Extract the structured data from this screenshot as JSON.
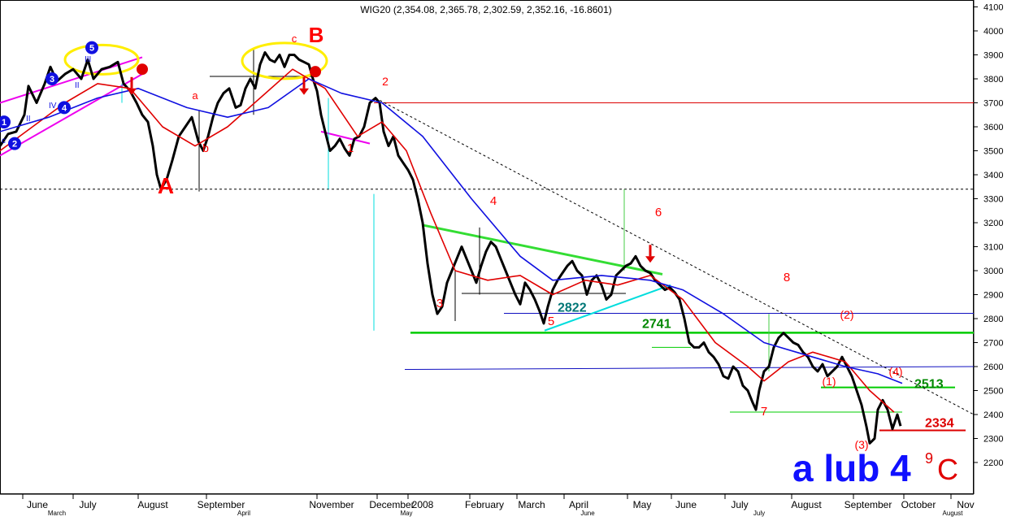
{
  "chart_data": {
    "type": "line",
    "title": "WIG20 (2,354.08, 2,365.78, 2,302.59, 2,352.16, -16.8601)",
    "ylim": [
      2100,
      4150
    ],
    "y_ticks": [
      2200,
      2300,
      2400,
      2500,
      2600,
      2700,
      2800,
      2900,
      3000,
      3100,
      3200,
      3300,
      3400,
      3500,
      3600,
      3700,
      3800,
      3900,
      4000,
      4100
    ],
    "x_month_labels": [
      "June",
      "July",
      "August",
      "September",
      "November",
      "December",
      "2008",
      "February",
      "March",
      "April",
      "May",
      "June",
      "July",
      "August",
      "September",
      "October",
      "Nov"
    ],
    "x_small_labels": [
      "March",
      "April",
      "May",
      "June",
      "July",
      "August"
    ],
    "colors": {
      "price": "#000000",
      "ma_fast": "#e00000",
      "ma_slow": "#1010e0",
      "support": "#00cc00",
      "resistance_red": "#dd0000",
      "blue_level": "#1010c0",
      "trend_cyan": "#00dddd",
      "channel_magenta": "#ee00ee",
      "ellipse_yellow": "#ffee00",
      "wave_label": "#ff0000",
      "level_label_green": "#008800",
      "level_label_teal": "#007777"
    },
    "series": [
      {
        "values": [
          [
            0,
            3520
          ],
          [
            10,
            3570
          ],
          [
            20,
            3580
          ],
          [
            30,
            3650
          ],
          [
            35,
            3770
          ],
          [
            45,
            3700
          ],
          [
            55,
            3780
          ],
          [
            62,
            3850
          ],
          [
            70,
            3790
          ],
          [
            80,
            3820
          ],
          [
            90,
            3840
          ],
          [
            100,
            3800
          ],
          [
            108,
            3880
          ],
          [
            115,
            3800
          ],
          [
            125,
            3840
          ],
          [
            135,
            3850
          ],
          [
            145,
            3870
          ],
          [
            152,
            3780
          ],
          [
            160,
            3750
          ],
          [
            168,
            3700
          ],
          [
            175,
            3650
          ],
          [
            182,
            3620
          ],
          [
            188,
            3520
          ],
          [
            193,
            3400
          ],
          [
            198,
            3340
          ],
          [
            205,
            3380
          ],
          [
            212,
            3460
          ],
          [
            220,
            3560
          ],
          [
            228,
            3600
          ],
          [
            236,
            3640
          ],
          [
            244,
            3540
          ],
          [
            250,
            3500
          ],
          [
            256,
            3560
          ],
          [
            262,
            3640
          ],
          [
            268,
            3700
          ],
          [
            275,
            3740
          ],
          [
            282,
            3760
          ],
          [
            290,
            3680
          ],
          [
            296,
            3690
          ],
          [
            302,
            3760
          ],
          [
            308,
            3800
          ],
          [
            314,
            3760
          ],
          [
            320,
            3860
          ],
          [
            326,
            3910
          ],
          [
            332,
            3880
          ],
          [
            338,
            3870
          ],
          [
            344,
            3900
          ],
          [
            350,
            3850
          ],
          [
            356,
            3900
          ],
          [
            362,
            3900
          ],
          [
            368,
            3880
          ],
          [
            374,
            3870
          ],
          [
            380,
            3860
          ],
          [
            385,
            3800
          ],
          [
            390,
            3750
          ],
          [
            395,
            3650
          ],
          [
            400,
            3580
          ],
          [
            406,
            3500
          ],
          [
            412,
            3520
          ],
          [
            418,
            3550
          ],
          [
            424,
            3510
          ],
          [
            430,
            3480
          ],
          [
            436,
            3550
          ],
          [
            442,
            3560
          ],
          [
            448,
            3600
          ],
          [
            455,
            3700
          ],
          [
            462,
            3720
          ],
          [
            467,
            3700
          ],
          [
            472,
            3580
          ],
          [
            478,
            3520
          ],
          [
            484,
            3560
          ],
          [
            490,
            3480
          ],
          [
            496,
            3450
          ],
          [
            502,
            3420
          ],
          [
            508,
            3380
          ],
          [
            514,
            3300
          ],
          [
            520,
            3200
          ],
          [
            526,
            3030
          ],
          [
            532,
            2900
          ],
          [
            538,
            2820
          ],
          [
            544,
            2850
          ],
          [
            550,
            2950
          ],
          [
            556,
            3000
          ],
          [
            562,
            3050
          ],
          [
            568,
            3100
          ],
          [
            574,
            3050
          ],
          [
            580,
            3000
          ],
          [
            586,
            2950
          ],
          [
            592,
            3020
          ],
          [
            598,
            3080
          ],
          [
            604,
            3120
          ],
          [
            610,
            3100
          ],
          [
            616,
            3050
          ],
          [
            622,
            3000
          ],
          [
            628,
            2950
          ],
          [
            634,
            2900
          ],
          [
            640,
            2860
          ],
          [
            646,
            2950
          ],
          [
            652,
            2920
          ],
          [
            658,
            2880
          ],
          [
            664,
            2830
          ],
          [
            669,
            2780
          ],
          [
            674,
            2850
          ],
          [
            680,
            2920
          ],
          [
            686,
            2960
          ],
          [
            692,
            2990
          ],
          [
            698,
            3020
          ],
          [
            704,
            3040
          ],
          [
            710,
            3000
          ],
          [
            716,
            2980
          ],
          [
            722,
            2900
          ],
          [
            728,
            2960
          ],
          [
            734,
            2980
          ],
          [
            740,
            2940
          ],
          [
            746,
            2880
          ],
          [
            752,
            2900
          ],
          [
            758,
            2980
          ],
          [
            764,
            3000
          ],
          [
            770,
            3020
          ],
          [
            776,
            3030
          ],
          [
            782,
            3060
          ],
          [
            788,
            3020
          ],
          [
            794,
            3000
          ],
          [
            800,
            2990
          ],
          [
            806,
            2960
          ],
          [
            812,
            2940
          ],
          [
            818,
            2920
          ],
          [
            824,
            2930
          ],
          [
            830,
            2910
          ],
          [
            836,
            2880
          ],
          [
            842,
            2800
          ],
          [
            848,
            2700
          ],
          [
            854,
            2680
          ],
          [
            860,
            2680
          ],
          [
            866,
            2700
          ],
          [
            872,
            2660
          ],
          [
            878,
            2640
          ],
          [
            884,
            2610
          ],
          [
            890,
            2560
          ],
          [
            896,
            2550
          ],
          [
            902,
            2600
          ],
          [
            908,
            2580
          ],
          [
            914,
            2520
          ],
          [
            920,
            2500
          ],
          [
            926,
            2450
          ],
          [
            930,
            2420
          ],
          [
            934,
            2500
          ],
          [
            940,
            2580
          ],
          [
            946,
            2600
          ],
          [
            952,
            2680
          ],
          [
            958,
            2720
          ],
          [
            964,
            2740
          ],
          [
            970,
            2720
          ],
          [
            976,
            2700
          ],
          [
            982,
            2690
          ],
          [
            988,
            2660
          ],
          [
            994,
            2640
          ],
          [
            1000,
            2600
          ],
          [
            1006,
            2580
          ],
          [
            1012,
            2610
          ],
          [
            1018,
            2560
          ],
          [
            1024,
            2580
          ],
          [
            1030,
            2600
          ],
          [
            1036,
            2640
          ],
          [
            1042,
            2600
          ],
          [
            1048,
            2560
          ],
          [
            1054,
            2500
          ],
          [
            1060,
            2440
          ],
          [
            1066,
            2350
          ],
          [
            1070,
            2280
          ],
          [
            1076,
            2300
          ],
          [
            1080,
            2420
          ],
          [
            1086,
            2460
          ],
          [
            1092,
            2420
          ],
          [
            1098,
            2340
          ],
          [
            1104,
            2400
          ],
          [
            1108,
            2352
          ]
        ]
      },
      {
        "values": [
          [
            0,
            3500
          ],
          [
            40,
            3600
          ],
          [
            80,
            3700
          ],
          [
            120,
            3780
          ],
          [
            160,
            3760
          ],
          [
            200,
            3600
          ],
          [
            240,
            3520
          ],
          [
            280,
            3600
          ],
          [
            320,
            3720
          ],
          [
            360,
            3840
          ],
          [
            400,
            3760
          ],
          [
            440,
            3560
          ],
          [
            470,
            3620
          ],
          [
            500,
            3500
          ],
          [
            530,
            3240
          ],
          [
            560,
            3000
          ],
          [
            600,
            2960
          ],
          [
            640,
            2980
          ],
          [
            680,
            2900
          ],
          [
            720,
            2960
          ],
          [
            760,
            2940
          ],
          [
            800,
            2980
          ],
          [
            840,
            2880
          ],
          [
            880,
            2700
          ],
          [
            920,
            2600
          ],
          [
            940,
            2540
          ],
          [
            970,
            2620
          ],
          [
            1000,
            2660
          ],
          [
            1040,
            2620
          ],
          [
            1070,
            2500
          ],
          [
            1100,
            2410
          ]
        ]
      },
      {
        "values": [
          [
            0,
            3580
          ],
          [
            60,
            3640
          ],
          [
            120,
            3720
          ],
          [
            170,
            3760
          ],
          [
            230,
            3680
          ],
          [
            280,
            3640
          ],
          [
            330,
            3680
          ],
          [
            380,
            3800
          ],
          [
            420,
            3740
          ],
          [
            470,
            3700
          ],
          [
            520,
            3560
          ],
          [
            580,
            3300
          ],
          [
            640,
            3060
          ],
          [
            680,
            2960
          ],
          [
            740,
            2980
          ],
          [
            800,
            2960
          ],
          [
            840,
            2920
          ],
          [
            890,
            2820
          ],
          [
            940,
            2700
          ],
          [
            990,
            2650
          ],
          [
            1040,
            2600
          ],
          [
            1080,
            2570
          ],
          [
            1110,
            2530
          ]
        ]
      }
    ],
    "horizontal_levels": [
      {
        "value": 3700,
        "color": "resistance_red"
      },
      {
        "value": 3340,
        "color": "dotted_black"
      },
      {
        "value": 2822,
        "label": "2822",
        "color": "blue_level"
      },
      {
        "value": 2741,
        "label": "2741",
        "color": "support"
      },
      {
        "value": 2513,
        "label": "2513",
        "color": "support"
      },
      {
        "value": 2334,
        "label": "2334",
        "color": "resistance_red"
      }
    ],
    "wave_labels_red": [
      "A",
      "B",
      "c",
      "a",
      "b",
      "1",
      "2",
      "3",
      "4",
      "5",
      "6",
      "7",
      "8",
      "(1)",
      "(2)",
      "(3)",
      "(4)"
    ],
    "wave_labels_blue_circled": [
      "1",
      "2",
      "3",
      "4",
      "5"
    ],
    "wave_labels_blue_roman": [
      "II",
      "IV",
      "II",
      "III",
      "c"
    ],
    "big_label": "a lub 4",
    "big_label_superscript": "9",
    "big_label_suffix": "C"
  }
}
